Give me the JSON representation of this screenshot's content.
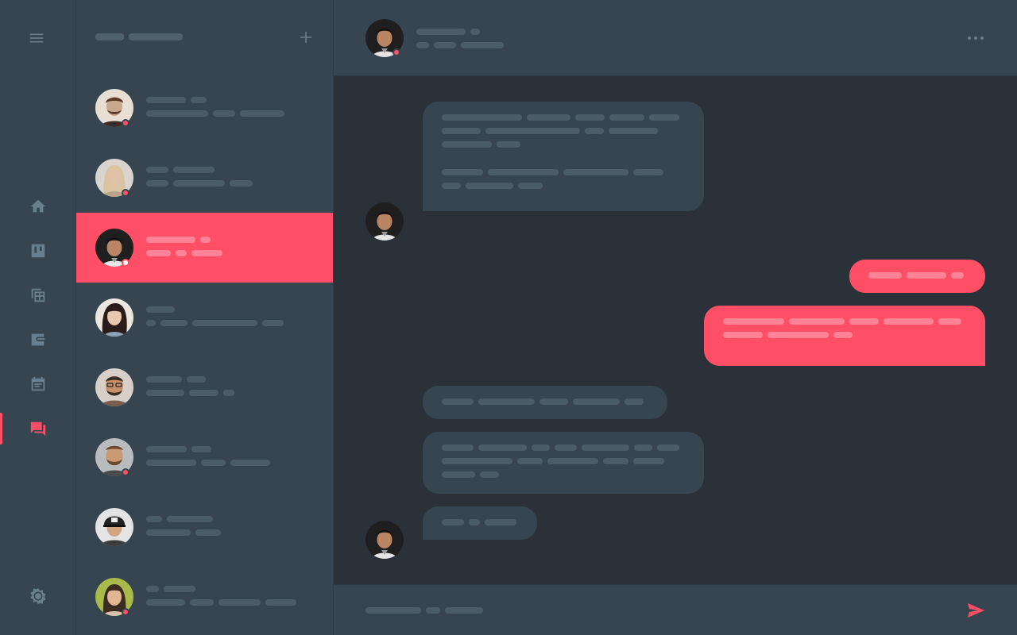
{
  "colors": {
    "accent": "#ff4f66",
    "rail_bg": "#364550",
    "chat_bg": "#2a3139",
    "placeholder": "#4a5c68",
    "icon": "#6a7f8d"
  },
  "rail": {
    "menu_icon": "hamburger-menu-icon",
    "nav_icons": [
      "home-icon",
      "board-icon",
      "table-icon",
      "wallet-icon",
      "calendar-icon",
      "chat-icon"
    ],
    "active_item": "chat-icon",
    "bottom_icon": "brightness-icon"
  },
  "contacts": {
    "add_icon": "plus-icon",
    "active_index": 2,
    "items": [
      {
        "avatar_tone": "#c9a98e",
        "hair": "#5a3b2a",
        "online": true
      },
      {
        "avatar_tone": "#e2c2a7",
        "hair": "#d9c3a0",
        "online": true
      },
      {
        "avatar_tone": "#b98564",
        "hair": "#1c1c1c",
        "online": true
      },
      {
        "avatar_tone": "#e9c8b0",
        "hair": "#2a1c18",
        "online": false
      },
      {
        "avatar_tone": "#c8906b",
        "hair": "#3a2d24",
        "online": false
      },
      {
        "avatar_tone": "#c99a74",
        "hair": "#6b4a2c",
        "online": true
      },
      {
        "avatar_tone": "#d2a482",
        "hair": "#222222",
        "online": false
      },
      {
        "avatar_tone": "#e3b794",
        "hair": "#3b2b20",
        "online": true
      }
    ]
  },
  "chat": {
    "more_icon": "more-horizontal-icon",
    "send_icon": "send-icon",
    "header_online": true
  }
}
